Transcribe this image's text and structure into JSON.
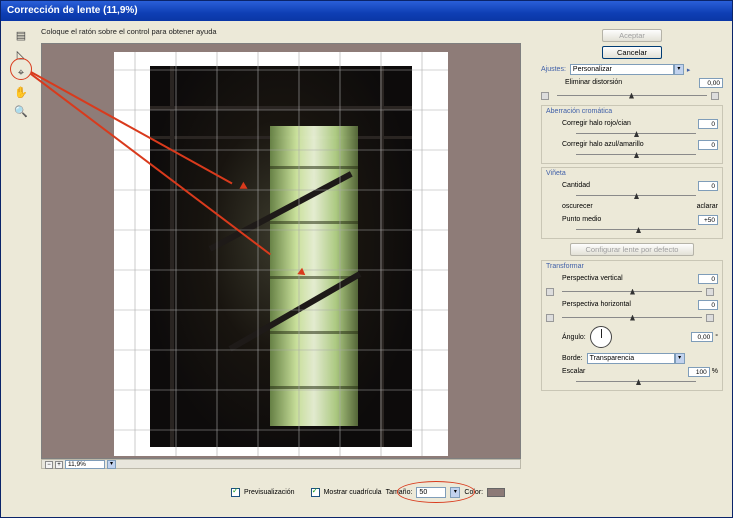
{
  "window": {
    "title": "Corrección de lente (11,9%)"
  },
  "hint": "Coloque el ratón sobre el control para obtener ayuda",
  "tools": [
    {
      "name": "remove-distortion-tool-icon",
      "glyph": "▤"
    },
    {
      "name": "straighten-tool-icon",
      "glyph": "◺"
    },
    {
      "name": "move-grid-tool-icon",
      "glyph": "⌖"
    },
    {
      "name": "hand-tool-icon",
      "glyph": "✋"
    },
    {
      "name": "zoom-tool-icon",
      "glyph": "🔍"
    }
  ],
  "zoom": {
    "minus": "−",
    "plus": "+",
    "value": "11,9%",
    "arrow": "▾"
  },
  "bottom": {
    "preview_label": "Previsualización",
    "grid_label": "Mostrar cuadrícula",
    "size_label": "Tamaño:",
    "size_value": "50",
    "size_arrow": "▾",
    "color_label": "Color:"
  },
  "panel": {
    "ok": "Aceptar",
    "cancel": "Cancelar",
    "settings_label": "Ajustes:",
    "settings_value": "Personalizar",
    "settings_arrow": "▾",
    "settings_menu": "▸",
    "remove_distortion": {
      "label": "Eliminar distorsión",
      "value": "0,00"
    },
    "chromatic": {
      "title": "Aberración cromática",
      "red_cyan": {
        "label": "Corregir halo rojo/cian",
        "value": "0"
      },
      "blue_yellow": {
        "label": "Corregir halo azul/amarillo",
        "value": "0"
      }
    },
    "vignette": {
      "title": "Viñeta",
      "amount": {
        "label": "Cantidad",
        "value": "0"
      },
      "darken": "oscurecer",
      "lighten": "aclarar",
      "midpoint": {
        "label": "Punto medio",
        "value": "+50"
      }
    },
    "lens_default": "Configurar lente por defecto",
    "transform": {
      "title": "Transformar",
      "vertical": {
        "label": "Perspectiva vertical",
        "value": "0"
      },
      "horizontal": {
        "label": "Perspectiva horizontal",
        "value": "0"
      },
      "angle": {
        "label": "Ángulo:",
        "value": "0,00",
        "unit": "°"
      },
      "edge_label": "Borde:",
      "edge_value": "Transparencia",
      "edge_arrow": "▾",
      "scale": {
        "label": "Escalar",
        "value": "100",
        "unit": "%"
      }
    }
  }
}
